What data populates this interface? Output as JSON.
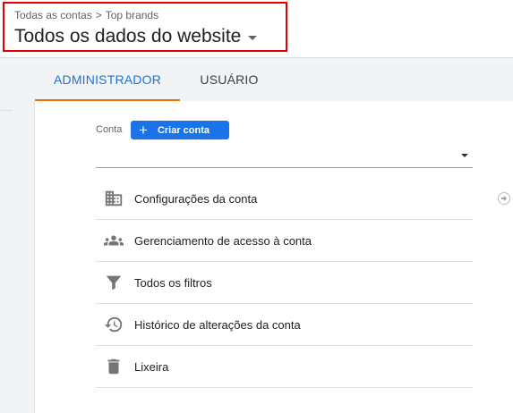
{
  "header": {
    "breadcrumb": {
      "account": "Todas as contas",
      "separator": ">",
      "property": "Top brands"
    },
    "view_title": "Todos os dados do website"
  },
  "tabs": [
    {
      "label": "ADMINISTRADOR",
      "active": true
    },
    {
      "label": "USUÁRIO",
      "active": false
    }
  ],
  "account_panel": {
    "conta_label": "Conta",
    "create_button": "Criar conta",
    "account_select_value": ""
  },
  "menu": [
    {
      "label": "Configurações da conta",
      "icon": "building-icon"
    },
    {
      "label": "Gerenciamento de acesso à conta",
      "icon": "people-icon"
    },
    {
      "label": "Todos os filtros",
      "icon": "filter-icon"
    },
    {
      "label": "Histórico de alterações da conta",
      "icon": "history-icon"
    },
    {
      "label": "Lixeira",
      "icon": "trash-icon"
    }
  ],
  "colors": {
    "accent": "#1a73e8",
    "tab_underline": "#e8710a",
    "highlight_box": "#e00000",
    "icon": "#757575"
  }
}
